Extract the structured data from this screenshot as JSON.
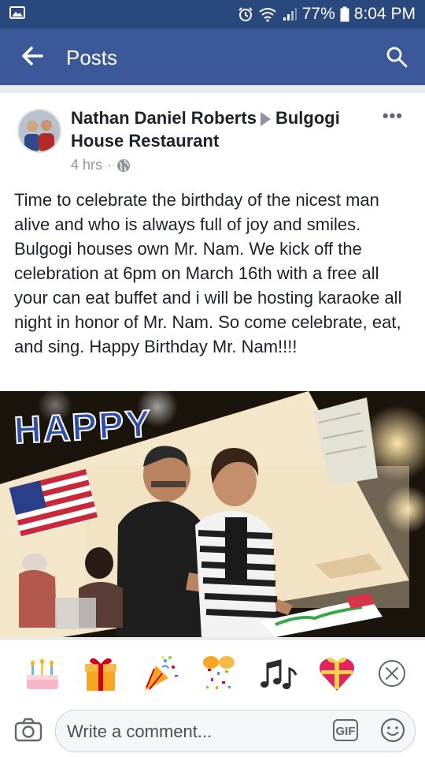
{
  "status_bar": {
    "battery": "77%",
    "time": "8:04 PM"
  },
  "app_bar": {
    "title": "Posts"
  },
  "post": {
    "author": "Nathan Daniel Roberts",
    "target": "Bulgogi House Restaurant",
    "time": "4 hrs",
    "text": "Time to celebrate the birthday of the nicest man alive and who is always full of joy and smiles. Bulgogi houses own Mr. Nam. We kick off the celebration at 6pm on March 16th with a free all your can eat buffet and i will be hosting karaoke all night in honor of Mr. Nam. So come celebrate, eat, and sing. Happy Birthday Mr. Nam!!!!",
    "photo_overlay_text": "HAPPY"
  },
  "reactions": [
    "cake",
    "gift",
    "party-popper",
    "confetti",
    "music-notes",
    "heart-gift"
  ],
  "composer": {
    "placeholder": "Write a comment...",
    "gif_label": "GIF"
  },
  "colors": {
    "status_bar": "#29487d",
    "app_bar": "#3b5998",
    "text": "#1d2129",
    "meta": "#90949c"
  }
}
